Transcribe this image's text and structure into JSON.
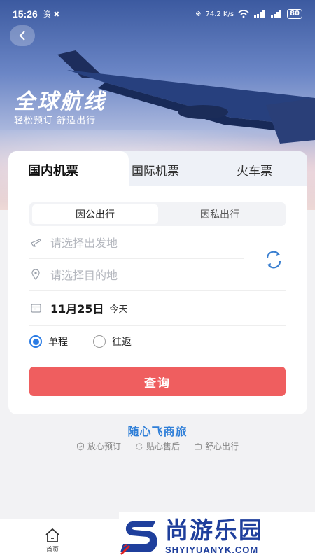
{
  "status_bar": {
    "time": "15:26",
    "left_icons": "资 ✖",
    "network": "74.2 K/s",
    "battery": "80"
  },
  "hero": {
    "title": "全球航线",
    "subtitle": "轻松预订  舒适出行"
  },
  "tabs": [
    {
      "label": "国内机票",
      "active": true
    },
    {
      "label": "国际机票",
      "active": false
    },
    {
      "label": "火车票",
      "active": false
    }
  ],
  "trip_type": {
    "business": "因公出行",
    "personal": "因私出行",
    "selected": "business"
  },
  "form": {
    "departure_placeholder": "请选择出发地",
    "destination_placeholder": "请选择目的地",
    "date": "11月25日",
    "date_note": "今天",
    "one_way": "单程",
    "round_trip": "往返",
    "selected_trip": "one_way",
    "query_label": "查询"
  },
  "brand": {
    "name": "随心飞商旅",
    "features": [
      "放心预订",
      "贴心售后",
      "舒心出行"
    ]
  },
  "bottom_nav": {
    "home": "首页"
  },
  "watermark": {
    "cn": "尚游乐园",
    "en": "SHYIYUANYK.COM"
  },
  "colors": {
    "accent": "#2a7be4",
    "query_button": "#ef5e5f",
    "brand_blue": "#2f7fd8",
    "watermark_blue": "#1f3f9c"
  }
}
